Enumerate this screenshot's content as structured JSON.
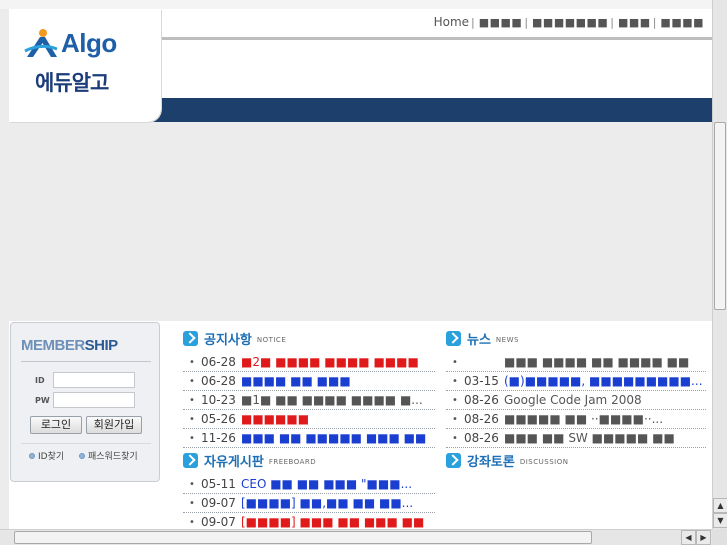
{
  "logo": {
    "name": "Algo",
    "subtitle": "에듀알고",
    "brand_color": "#1f5fa8"
  },
  "topnav": {
    "items": [
      {
        "label": "Home"
      },
      {
        "label": "■■■■"
      },
      {
        "label": "■■■■■■■"
      },
      {
        "label": "■■■"
      },
      {
        "label": "■■■■"
      }
    ]
  },
  "membership": {
    "title_a": "MEMBER",
    "title_b": "SHIP",
    "id_label": "ID",
    "pw_label": "PW",
    "login_label": "로그인",
    "join_label": "회원가입",
    "find_id_label": "ID찾기",
    "find_pw_label": "패스워드찾기"
  },
  "boards": {
    "notice": {
      "title": "공지사항",
      "sub": "NOTICE",
      "rows": [
        {
          "date": "06-28",
          "title": "■2■ ■■■■ ■■■■ ■■■■",
          "color": "red"
        },
        {
          "date": "06-28",
          "title": "■■■■ ■■ ■■■",
          "color": "blue"
        },
        {
          "date": "10-23",
          "title": "■1■ ■■ ■■■■ ■■■■ ■...",
          "color": "gray"
        },
        {
          "date": "05-26",
          "title": "■■■■■■",
          "color": "red"
        },
        {
          "date": "11-26",
          "title": "■■■ ■■ ■■■■■ ■■■ ■■",
          "color": "blue"
        }
      ]
    },
    "news": {
      "title": "뉴스",
      "sub": "NEWS",
      "rows": [
        {
          "date": "",
          "title": "■■■ ■■■■ ■■ ■■■■ ■■",
          "color": "gray"
        },
        {
          "date": "03-15",
          "title": "(■)■■■■■, ■■■■■■■■■...",
          "color": "blue"
        },
        {
          "date": "08-26",
          "title": "Google Code Jam 2008",
          "color": "gray"
        },
        {
          "date": "08-26",
          "title": "■■■■■ ■■ ··■■■■··...",
          "color": "gray"
        },
        {
          "date": "08-26",
          "title": "■■■ ■■ SW ■■■■■ ■■",
          "color": "gray"
        }
      ]
    },
    "freeboard": {
      "title": "자유게시판",
      "sub": "FREEBOARD",
      "rows": [
        {
          "date": "05-11",
          "title": "CEO ■■ ■■ ■■■ \"■■■...",
          "color": "blue"
        },
        {
          "date": "09-07",
          "title": "[■■■■] ■■,■■ ■■ ■■...",
          "color": "blue"
        },
        {
          "date": "09-07",
          "title": "[■■■■] ■■■ ■■ ■■■ ■■",
          "color": "red"
        }
      ]
    },
    "discussion": {
      "title": "강좌토론",
      "sub": "DISCUSSION"
    }
  },
  "colors": {
    "header_band": "#1c3f6b",
    "board_title": "#1c6fb5",
    "link_blue": "#1a3fd0",
    "link_red": "#e01a1a"
  }
}
